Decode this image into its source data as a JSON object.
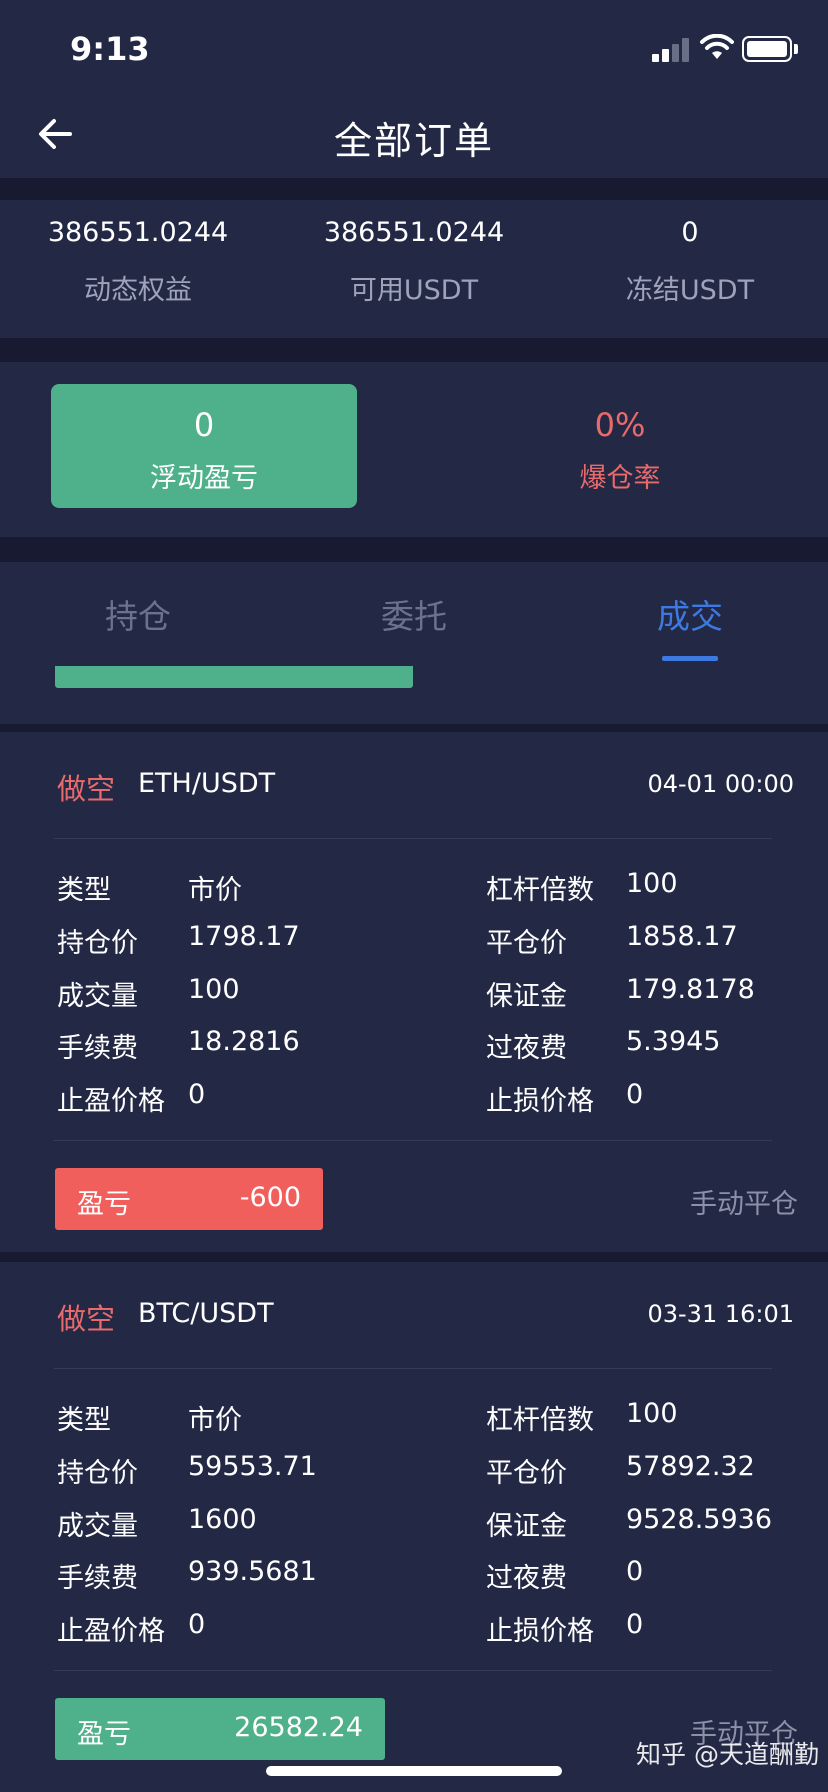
{
  "status_bar": {
    "time": "9:13"
  },
  "header": {
    "title": "全部订单"
  },
  "stats": [
    {
      "value": "386551.0244",
      "label": "动态权益"
    },
    {
      "value": "386551.0244",
      "label": "可用USDT"
    },
    {
      "value": "0",
      "label": "冻结USDT"
    }
  ],
  "pnl": {
    "floating_value": "0",
    "floating_label": "浮动盈亏",
    "liquidation_value": "0%",
    "liquidation_label": "爆仓率"
  },
  "tabs": [
    {
      "label": "持仓",
      "active": false
    },
    {
      "label": "委托",
      "active": false
    },
    {
      "label": "成交",
      "active": true
    }
  ],
  "orders": [
    {
      "direction": "做空",
      "pair": "ETH/USDT",
      "datetime": "04-01 00:00",
      "fields_left": [
        {
          "label": "类型",
          "value": "市价"
        },
        {
          "label": "持仓价",
          "value": "1798.17"
        },
        {
          "label": "成交量",
          "value": "100"
        },
        {
          "label": "手续费",
          "value": "18.2816"
        },
        {
          "label": "止盈价格",
          "value": "0"
        }
      ],
      "fields_right": [
        {
          "label": "杠杆倍数",
          "value": "100"
        },
        {
          "label": "平仓价",
          "value": "1858.17"
        },
        {
          "label": "保证金",
          "value": "179.8178"
        },
        {
          "label": "过夜费",
          "value": "5.3945"
        },
        {
          "label": "止损价格",
          "value": "0"
        }
      ],
      "pnl_label": "盈亏",
      "pnl_value": "-600",
      "pnl_color": "#f15f5c",
      "close_type": "手动平仓"
    },
    {
      "direction": "做空",
      "pair": "BTC/USDT",
      "datetime": "03-31 16:01",
      "fields_left": [
        {
          "label": "类型",
          "value": "市价"
        },
        {
          "label": "持仓价",
          "value": "59553.71"
        },
        {
          "label": "成交量",
          "value": "1600"
        },
        {
          "label": "手续费",
          "value": "939.5681"
        },
        {
          "label": "止盈价格",
          "value": "0"
        }
      ],
      "fields_right": [
        {
          "label": "杠杆倍数",
          "value": "100"
        },
        {
          "label": "平仓价",
          "value": "57892.32"
        },
        {
          "label": "保证金",
          "value": "9528.5936"
        },
        {
          "label": "过夜费",
          "value": "0"
        },
        {
          "label": "止损价格",
          "value": "0"
        }
      ],
      "pnl_label": "盈亏",
      "pnl_value": "26582.24",
      "pnl_color": "#4fb08c",
      "close_type": "手动平仓"
    }
  ],
  "watermark": "知乎 @天道酬勤",
  "colors": {
    "background": "#1d2140",
    "card": "#232845",
    "profit_green": "#4fb08c",
    "loss_red": "#f15f5c",
    "accent_blue": "#3d79e0"
  }
}
